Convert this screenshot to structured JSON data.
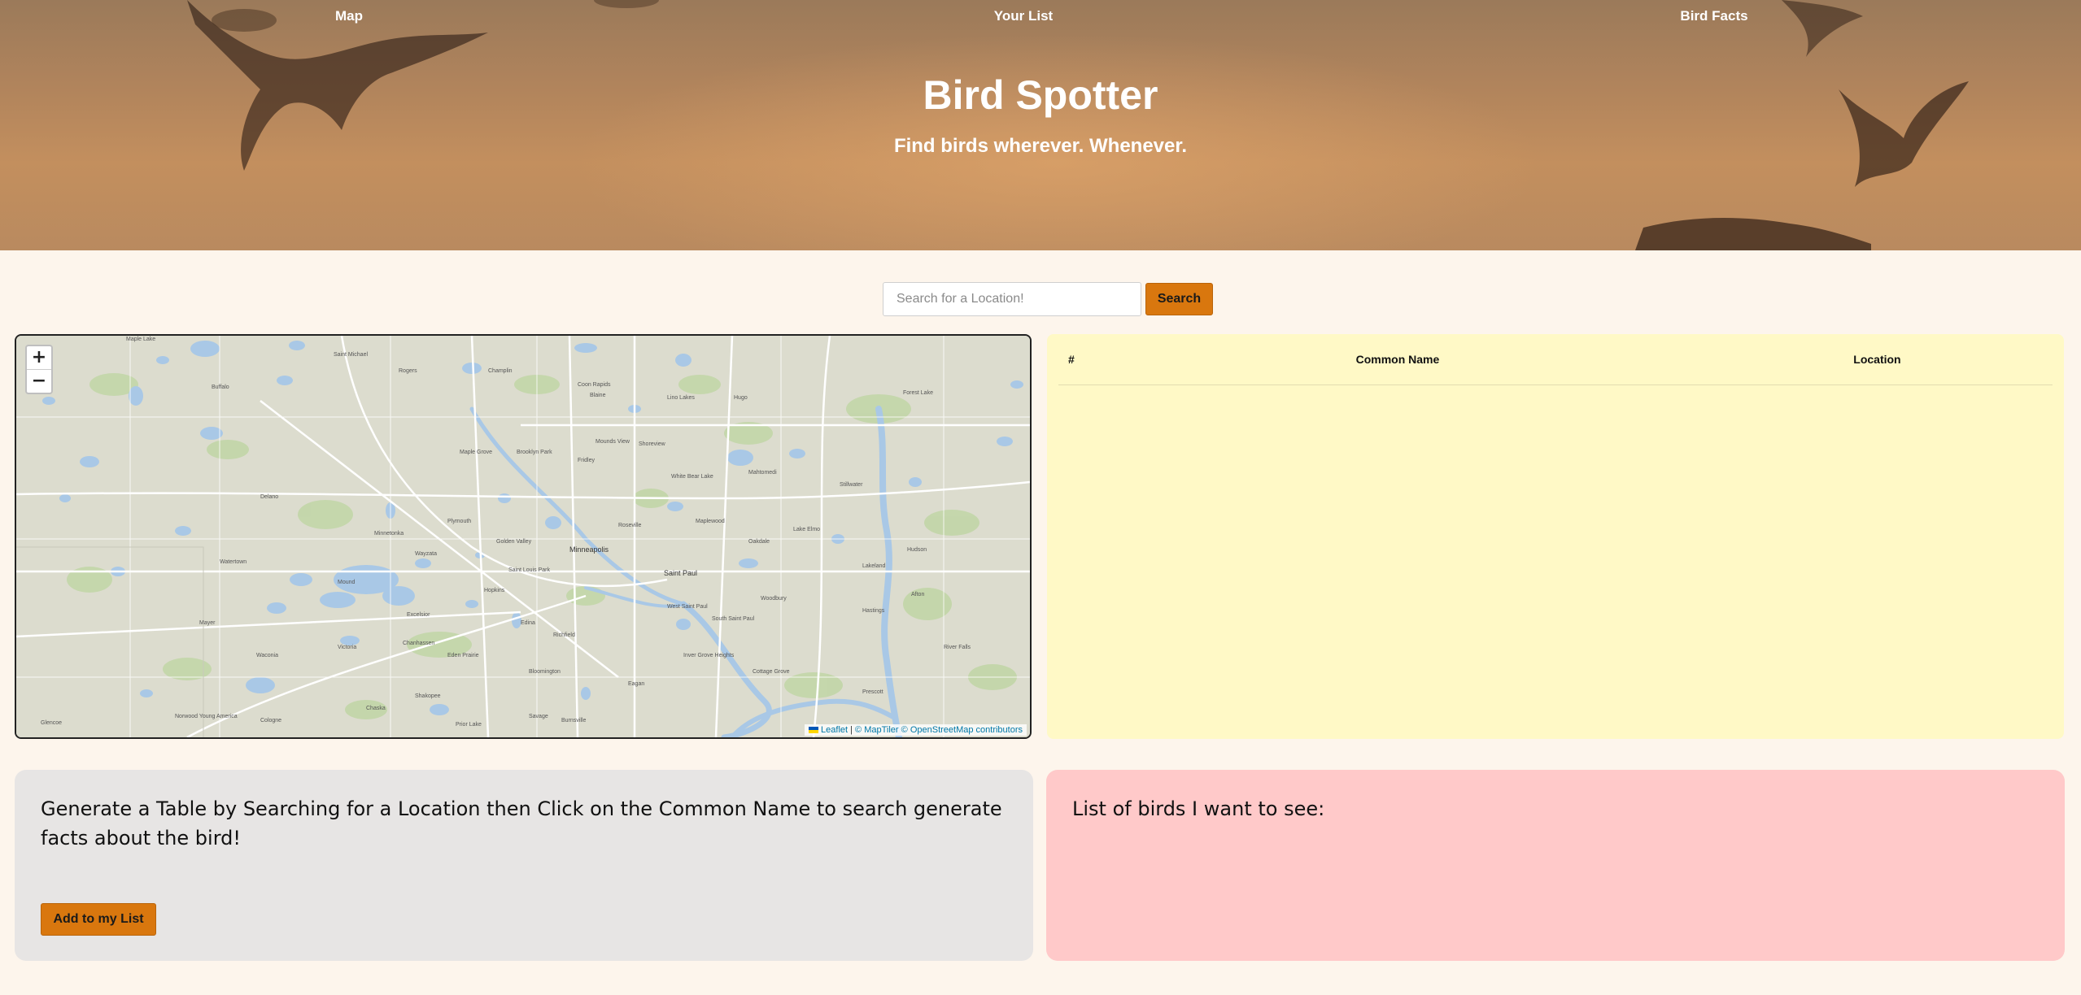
{
  "nav": {
    "items": [
      {
        "label": "Map"
      },
      {
        "label": "Your List"
      },
      {
        "label": "Bird Facts"
      }
    ]
  },
  "hero": {
    "title": "Bird Spotter",
    "subtitle": "Find birds wherever. Whenever."
  },
  "search": {
    "placeholder": "Search for a Location!",
    "value": "",
    "button_label": "Search"
  },
  "map": {
    "zoom_in_label": "+",
    "zoom_out_label": "−",
    "attribution": {
      "leaflet": "Leaflet",
      "separator": "|",
      "maptiler": "© MapTiler",
      "osm": "© OpenStreetMap contributors"
    },
    "labels": {
      "minneapolis": "Minneapolis",
      "saint_paul": "Saint Paul",
      "maple_lake": "Maple Lake",
      "saint_michael": "Saint Michael",
      "buffalo": "Buffalo",
      "rogers": "Rogers",
      "champlin": "Champlin",
      "coon_rapids": "Coon Rapids",
      "blaine": "Blaine",
      "lino_lakes": "Lino Lakes",
      "hugo": "Hugo",
      "forest_lake": "Forest Lake",
      "maple_grove": "Maple Grove",
      "brooklyn_park": "Brooklyn Park",
      "fridley": "Fridley",
      "mounds_view": "Mounds View",
      "shoreview": "Shoreview",
      "white_bear_lake": "White Bear Lake",
      "mahtomedi": "Mahtomedi",
      "stillwater": "Stillwater",
      "plymouth": "Plymouth",
      "golden_valley": "Golden Valley",
      "roseville": "Roseville",
      "maplewood": "Maplewood",
      "oakdale": "Oakdale",
      "lake_elmo": "Lake Elmo",
      "hudson": "Hudson",
      "wayzata": "Wayzata",
      "minnetonka": "Minnetonka",
      "hopkins": "Hopkins",
      "saint_louis_park": "Saint Louis Park",
      "edina": "Edina",
      "richfield": "Richfield",
      "bloomington": "Bloomington",
      "eagan": "Eagan",
      "woodbury": "Woodbury",
      "cottage_grove": "Cottage Grove",
      "inver_grove_heights": "Inver Grove Heights",
      "south_saint_paul": "South Saint Paul",
      "west_saint_paul": "West Saint Paul",
      "burnsville": "Burnsville",
      "savage": "Savage",
      "shakopee": "Shakopee",
      "prior_lake": "Prior Lake",
      "chanhassen": "Chanhassen",
      "eden_prairie": "Eden Prairie",
      "chaska": "Chaska",
      "waconia": "Waconia",
      "victoria": "Victoria",
      "excelsior": "Excelsior",
      "mound": "Mound",
      "delano": "Delano",
      "watertown": "Watertown",
      "mayer": "Mayer",
      "norwood_young_america": "Norwood Young America",
      "cologne": "Cologne",
      "glencoe": "Glencoe",
      "river_falls": "River Falls",
      "prescott": "Prescott",
      "hastings": "Hastings",
      "afton": "Afton",
      "lakeland": "Lakeland"
    }
  },
  "table": {
    "columns": [
      "#",
      "Common Name",
      "Location"
    ],
    "rows": []
  },
  "info_card": {
    "text": "Generate a Table by Searching for a Location then Click on the Common Name to search generate facts about the bird!",
    "button_label": "Add to my List"
  },
  "wishlist_card": {
    "title": "List of birds I want to see:",
    "items": []
  },
  "colors": {
    "page_bg": "#fdf5ec",
    "accent": "#d9770e",
    "table_bg": "#fff9c6",
    "info_card_bg": "#e7e5e4",
    "wishlist_bg": "#ffc9c9",
    "water": "#a9c8e6",
    "map_land": "#dcdcce"
  }
}
